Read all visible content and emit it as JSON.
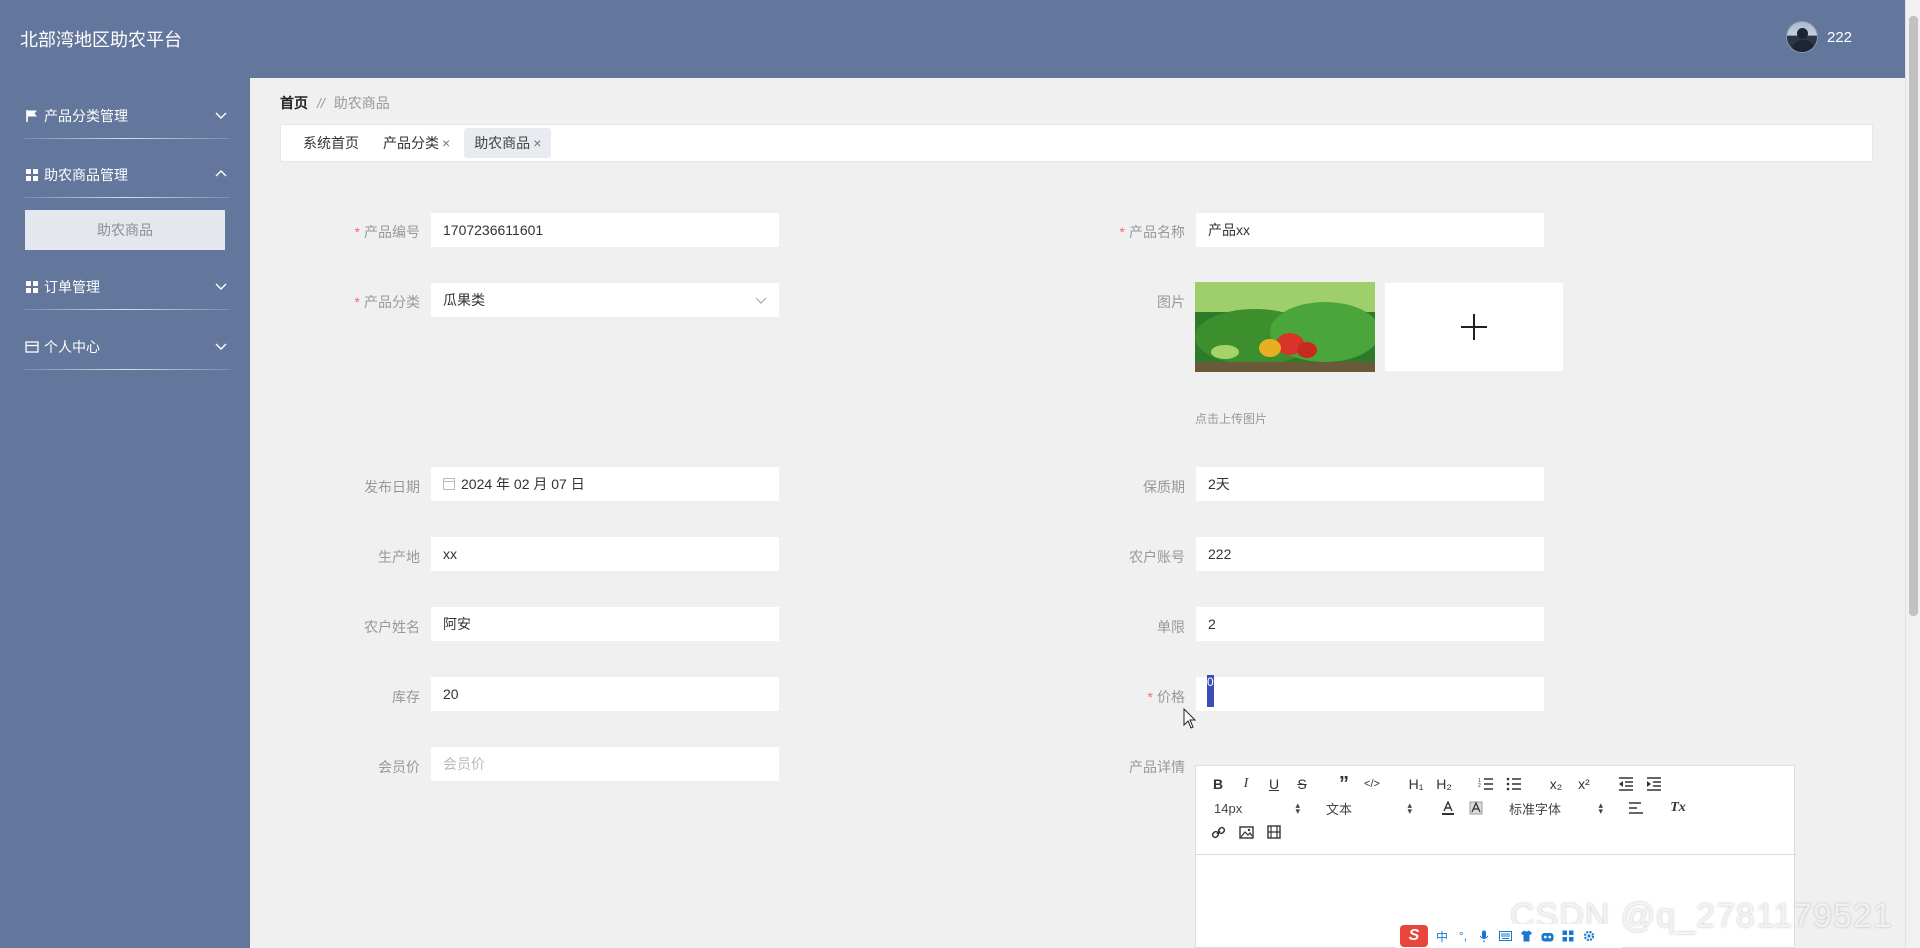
{
  "app": {
    "title": "北部湾地区助农平台",
    "username": "222"
  },
  "sidebar": {
    "groups": [
      {
        "label": "产品分类管理",
        "icon": "flag-icon"
      },
      {
        "label": "助农商品管理",
        "icon": "grid-icon",
        "sub": [
          {
            "label": "助农商品"
          }
        ]
      },
      {
        "label": "订单管理",
        "icon": "grid-icon"
      },
      {
        "label": "个人中心",
        "icon": "card-icon"
      }
    ]
  },
  "breadcrumb": {
    "home": "首页",
    "sep": "//",
    "current": "助农商品"
  },
  "tabs": [
    {
      "label": "系统首页"
    },
    {
      "label": "产品分类",
      "close": "×"
    },
    {
      "label": "助农商品",
      "close": "×"
    }
  ],
  "form": {
    "product_no": {
      "label": "产品编号",
      "value": "1707236611601"
    },
    "product_name": {
      "label": "产品名称",
      "value": "产品xx"
    },
    "category": {
      "label": "产品分类",
      "value": "瓜果类"
    },
    "image": {
      "label": "图片",
      "hint": "点击上传图片"
    },
    "publish_date": {
      "label": "发布日期",
      "value": "2024 年 02 月 07 日"
    },
    "shelf_life": {
      "label": "保质期",
      "value": "2天"
    },
    "origin": {
      "label": "生产地",
      "value": "xx"
    },
    "farmer_account": {
      "label": "农户账号",
      "value": "222"
    },
    "farmer_name": {
      "label": "农户姓名",
      "value": "阿安"
    },
    "limit": {
      "label": "单限",
      "value": "2"
    },
    "stock": {
      "label": "库存",
      "value": "20"
    },
    "price": {
      "label": "价格",
      "value": "0"
    },
    "member_price": {
      "label": "会员价",
      "placeholder": "会员价"
    },
    "detail": {
      "label": "产品详情"
    }
  },
  "editor": {
    "buttons": {
      "bold": "B",
      "italic": "I",
      "underline": "U",
      "strike": "S",
      "quote": "”",
      "code": "</>",
      "h1": "H₁",
      "h2": "H₂",
      "sub": "x₂",
      "sup": "x²",
      "clean": "Tx"
    },
    "size": "14px",
    "header": "文本",
    "font": "标准字体"
  },
  "watermark": "CSDN @q_2781179521",
  "ime": {
    "logo": "S",
    "mode": "中",
    "punct": "°,"
  },
  "colors": {
    "sidebar": "#63769b",
    "required": "#f56c6c",
    "cursor": "#3a4db8"
  }
}
